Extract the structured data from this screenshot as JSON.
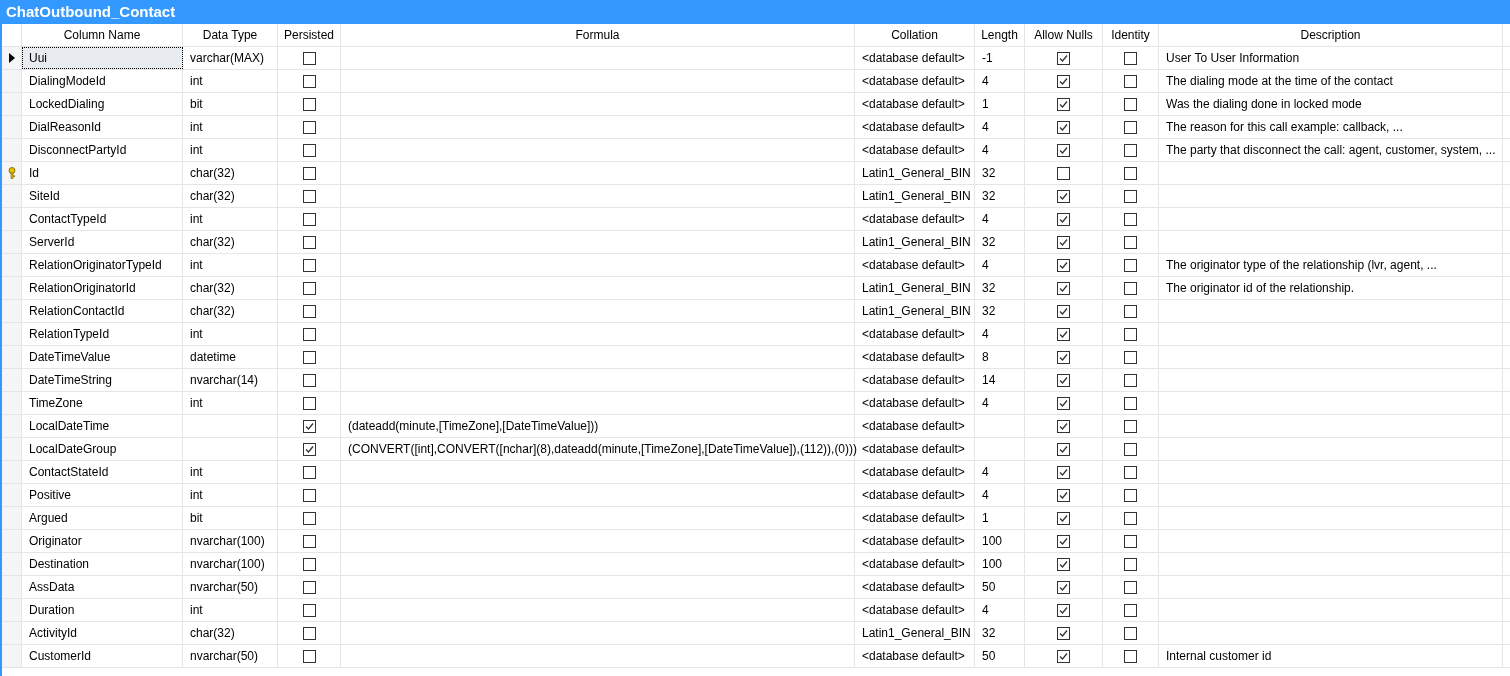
{
  "title": "ChatOutbound_Contact",
  "columns": [
    "Column Name",
    "Data Type",
    "Persisted",
    "Formula",
    "Collation",
    "Length",
    "Allow Nulls",
    "Identity",
    "Description"
  ],
  "rows": [
    {
      "selected": true,
      "primary_key": false,
      "name": "Uui",
      "type": "varchar(MAX)",
      "persisted": false,
      "formula": "",
      "collation": "<database default>",
      "length": "-1",
      "nulls": true,
      "identity": false,
      "description": "User To User Information"
    },
    {
      "selected": false,
      "primary_key": false,
      "name": "DialingModeId",
      "type": "int",
      "persisted": false,
      "collation": "<database default>",
      "length": "4",
      "nulls": true,
      "identity": false,
      "description": "The dialing mode at the time of the contact"
    },
    {
      "selected": false,
      "primary_key": false,
      "name": "LockedDialing",
      "type": "bit",
      "persisted": false,
      "collation": "<database default>",
      "length": "1",
      "nulls": true,
      "identity": false,
      "description": "Was the dialing done in locked mode"
    },
    {
      "selected": false,
      "primary_key": false,
      "name": "DialReasonId",
      "type": "int",
      "persisted": false,
      "collation": "<database default>",
      "length": "4",
      "nulls": true,
      "identity": false,
      "description": "The reason for this call example: callback, ..."
    },
    {
      "selected": false,
      "primary_key": false,
      "name": "DisconnectPartyId",
      "type": "int",
      "persisted": false,
      "collation": "<database default>",
      "length": "4",
      "nulls": true,
      "identity": false,
      "description": "The party that disconnect the call: agent, customer, system, ..."
    },
    {
      "selected": false,
      "primary_key": true,
      "name": "Id",
      "type": "char(32)",
      "persisted": false,
      "collation": "Latin1_General_BIN",
      "length": "32",
      "nulls": false,
      "identity": false
    },
    {
      "selected": false,
      "primary_key": false,
      "name": "SiteId",
      "type": "char(32)",
      "persisted": false,
      "collation": "Latin1_General_BIN",
      "length": "32",
      "nulls": true,
      "identity": false
    },
    {
      "selected": false,
      "primary_key": false,
      "name": "ContactTypeId",
      "type": "int",
      "persisted": false,
      "collation": "<database default>",
      "length": "4",
      "nulls": true,
      "identity": false
    },
    {
      "selected": false,
      "primary_key": false,
      "name": "ServerId",
      "type": "char(32)",
      "persisted": false,
      "collation": "Latin1_General_BIN",
      "length": "32",
      "nulls": true,
      "identity": false
    },
    {
      "selected": false,
      "primary_key": false,
      "name": "RelationOriginatorTypeId",
      "type": "int",
      "persisted": false,
      "collation": "<database default>",
      "length": "4",
      "nulls": true,
      "identity": false,
      "description": "The originator type of the relationship (lvr, agent, ..."
    },
    {
      "selected": false,
      "primary_key": false,
      "name": "RelationOriginatorId",
      "type": "char(32)",
      "persisted": false,
      "collation": "Latin1_General_BIN",
      "length": "32",
      "nulls": true,
      "identity": false,
      "description": "The originator id of the relationship."
    },
    {
      "selected": false,
      "primary_key": false,
      "name": "RelationContactId",
      "type": "char(32)",
      "persisted": false,
      "collation": "Latin1_General_BIN",
      "length": "32",
      "nulls": true,
      "identity": false
    },
    {
      "selected": false,
      "primary_key": false,
      "name": "RelationTypeId",
      "type": "int",
      "persisted": false,
      "collation": "<database default>",
      "length": "4",
      "nulls": true,
      "identity": false
    },
    {
      "selected": false,
      "primary_key": false,
      "name": "DateTimeValue",
      "type": "datetime",
      "persisted": false,
      "collation": "<database default>",
      "length": "8",
      "nulls": true,
      "identity": false
    },
    {
      "selected": false,
      "primary_key": false,
      "name": "DateTimeString",
      "type": "nvarchar(14)",
      "persisted": false,
      "collation": "<database default>",
      "length": "14",
      "nulls": true,
      "identity": false
    },
    {
      "selected": false,
      "primary_key": false,
      "name": "TimeZone",
      "type": "int",
      "persisted": false,
      "collation": "<database default>",
      "length": "4",
      "nulls": true,
      "identity": false
    },
    {
      "selected": false,
      "primary_key": false,
      "name": "LocalDateTime",
      "persisted": true,
      "formula": "(dateadd(minute,[TimeZone],[DateTimeValue]))",
      "collation": "<database default>",
      "nulls": true,
      "identity": false
    },
    {
      "selected": false,
      "primary_key": false,
      "name": "LocalDateGroup",
      "persisted": true,
      "formula": "(CONVERT([int],CONVERT([nchar](8),dateadd(minute,[TimeZone],[DateTimeValue]),(112)),(0)))",
      "collation": "<database default>",
      "nulls": true,
      "identity": false
    },
    {
      "selected": false,
      "primary_key": false,
      "name": "ContactStateId",
      "type": "int",
      "persisted": false,
      "collation": "<database default>",
      "length": "4",
      "nulls": true,
      "identity": false
    },
    {
      "selected": false,
      "primary_key": false,
      "name": "Positive",
      "type": "int",
      "persisted": false,
      "collation": "<database default>",
      "length": "4",
      "nulls": true,
      "identity": false
    },
    {
      "selected": false,
      "primary_key": false,
      "name": "Argued",
      "type": "bit",
      "persisted": false,
      "collation": "<database default>",
      "length": "1",
      "nulls": true,
      "identity": false
    },
    {
      "selected": false,
      "primary_key": false,
      "name": "Originator",
      "type": "nvarchar(100)",
      "persisted": false,
      "collation": "<database default>",
      "length": "100",
      "nulls": true,
      "identity": false
    },
    {
      "selected": false,
      "primary_key": false,
      "name": "Destination",
      "type": "nvarchar(100)",
      "persisted": false,
      "collation": "<database default>",
      "length": "100",
      "nulls": true,
      "identity": false
    },
    {
      "selected": false,
      "primary_key": false,
      "name": "AssData",
      "type": "nvarchar(50)",
      "persisted": false,
      "collation": "<database default>",
      "length": "50",
      "nulls": true,
      "identity": false
    },
    {
      "selected": false,
      "primary_key": false,
      "name": "Duration",
      "type": "int",
      "persisted": false,
      "collation": "<database default>",
      "length": "4",
      "nulls": true,
      "identity": false
    },
    {
      "selected": false,
      "primary_key": false,
      "name": "ActivityId",
      "type": "char(32)",
      "persisted": false,
      "collation": "Latin1_General_BIN",
      "length": "32",
      "nulls": true,
      "identity": false
    },
    {
      "selected": false,
      "primary_key": false,
      "name": "CustomerId",
      "type": "nvarchar(50)",
      "persisted": false,
      "collation": "<database default>",
      "length": "50",
      "nulls": true,
      "identity": false,
      "description": "Internal customer id"
    }
  ]
}
